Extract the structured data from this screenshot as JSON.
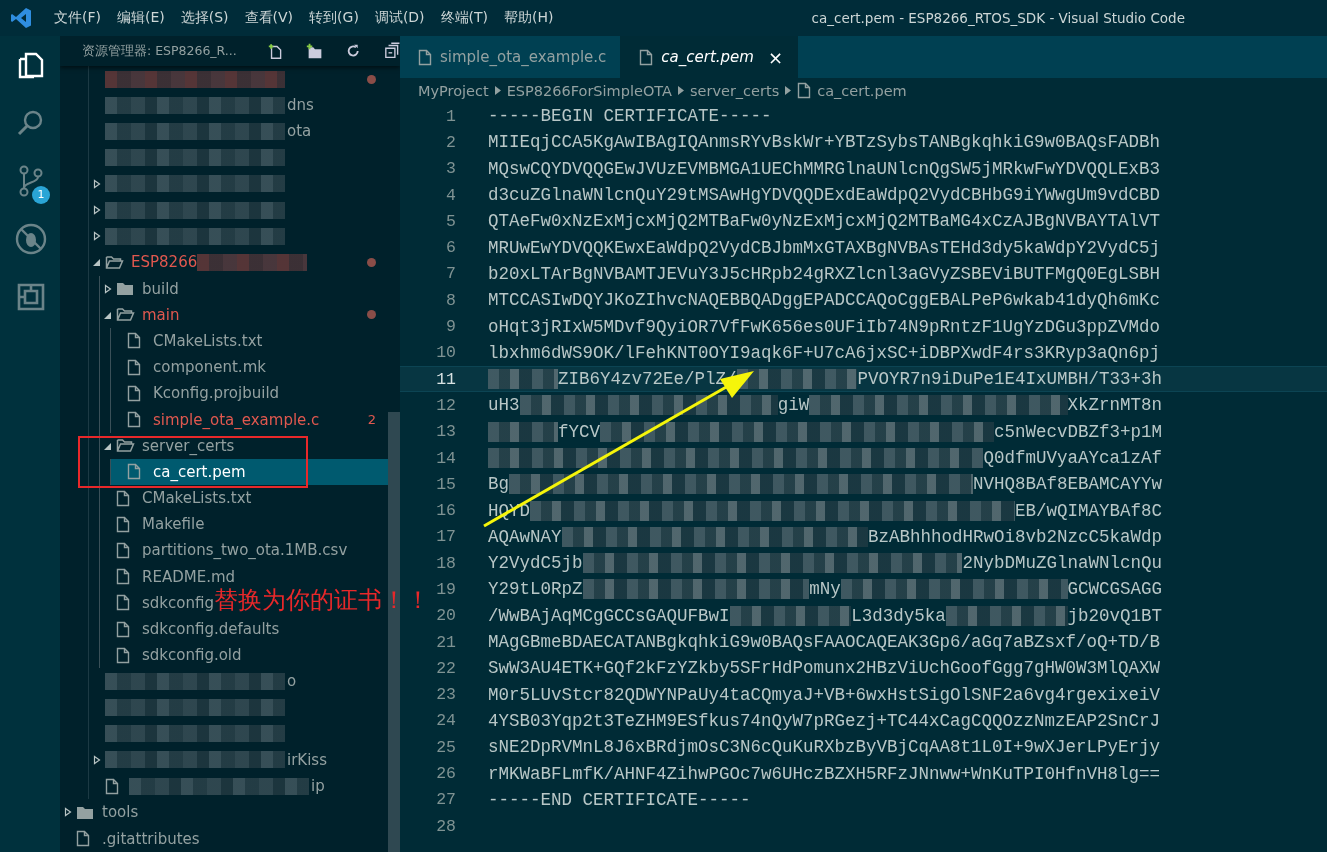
{
  "title_bar": {
    "menus": [
      "文件(F)",
      "编辑(E)",
      "选择(S)",
      "查看(V)",
      "转到(G)",
      "调试(D)",
      "终端(T)",
      "帮助(H)"
    ],
    "title": "ca_cert.pem - ESP8266_RTOS_SDK - Visual Studio Code"
  },
  "activity_bar": [
    {
      "kind": "explorer",
      "selected": true
    },
    {
      "kind": "search",
      "selected": false
    },
    {
      "kind": "source_control",
      "selected": false,
      "badge": "1"
    },
    {
      "kind": "debug",
      "selected": false
    },
    {
      "kind": "extensions",
      "selected": false
    }
  ],
  "sidebar": {
    "title": "资源管理器: ESP8266_R...",
    "tree": [
      {
        "kind": "group",
        "children": [
          {
            "kind": "blurred",
            "selected": false,
            "modified": true
          },
          {
            "kind": "blurred",
            "label": "dns",
            "selected": false,
            "modified": false
          },
          {
            "kind": "blurred",
            "label": "ota",
            "selected": false,
            "modified": false
          },
          {
            "kind": "blurred",
            "selected": false,
            "modified": false
          },
          {
            "kind": "blurred",
            "expanded": false,
            "selected": false,
            "modified": false
          },
          {
            "kind": "blurred",
            "expanded": false,
            "selected": false,
            "modified": false
          },
          {
            "kind": "blurred",
            "expanded": false,
            "selected": false,
            "modified": false
          },
          {
            "kind": "folder",
            "label": "ESP8266",
            "redacted": true,
            "expanded": true,
            "selected": false,
            "modified": true,
            "children": [
              {
                "kind": "folder",
                "label": "build",
                "expanded": false,
                "selected": false,
                "modified": false
              },
              {
                "kind": "folder",
                "label": "main",
                "expanded": true,
                "selected": false,
                "modified": true,
                "children": [
                  {
                    "kind": "file",
                    "label": "CMakeLists.txt",
                    "selected": false,
                    "modified": false
                  },
                  {
                    "kind": "file",
                    "label": "component.mk",
                    "selected": false,
                    "modified": false
                  },
                  {
                    "kind": "file",
                    "label": "Kconfig.projbuild",
                    "selected": false,
                    "modified": false
                  },
                  {
                    "kind": "file",
                    "label": "simple_ota_example.c",
                    "selected": false,
                    "modified": false,
                    "badge": "2"
                  }
                ]
              },
              {
                "kind": "folder",
                "label": "server_certs",
                "expanded": true,
                "selected": false,
                "modified": false,
                "children": [
                  {
                    "kind": "file",
                    "label": "ca_cert.pem",
                    "selected": true,
                    "modified": false
                  }
                ]
              },
              {
                "kind": "file",
                "label": "CMakeLists.txt",
                "selected": false,
                "modified": false
              },
              {
                "kind": "file",
                "label": "Makefile",
                "selected": false,
                "modified": false
              },
              {
                "kind": "file",
                "label": "partitions_two_ota.1MB.csv",
                "selected": false,
                "modified": false
              },
              {
                "kind": "file",
                "label": "README.md",
                "selected": false,
                "modified": false
              },
              {
                "kind": "file",
                "label": "sdkconfig",
                "selected": false,
                "modified": false
              },
              {
                "kind": "file",
                "label": "sdkconfig.defaults",
                "selected": false,
                "modified": false
              },
              {
                "kind": "file",
                "label": "sdkconfig.old",
                "selected": false,
                "modified": false
              }
            ]
          },
          {
            "kind": "blurred",
            "label": "o",
            "selected": false,
            "modified": false
          },
          {
            "kind": "blurred",
            "selected": false,
            "modified": false
          },
          {
            "kind": "blurred",
            "selected": false,
            "modified": false
          },
          {
            "kind": "blurred",
            "label": "irKiss",
            "expanded": false,
            "selected": false,
            "modified": false
          },
          {
            "kind": "blurred_file",
            "label": "ip",
            "selected": false,
            "modified": false
          }
        ]
      },
      {
        "kind": "folder",
        "label": "tools",
        "expanded": false,
        "selected": false,
        "modified": false
      },
      {
        "kind": "file",
        "label": ".gitattributes",
        "selected": false,
        "modified": false
      }
    ]
  },
  "editor": {
    "tabs": [
      {
        "label": "simple_ota_example.c",
        "selected": false
      },
      {
        "label": "ca_cert.pem",
        "selected": true,
        "close": "×"
      }
    ],
    "breadcrumbs": [
      {
        "label": "MyProject",
        "kind": "folder"
      },
      {
        "label": "ESP8266ForSimpleOTA",
        "kind": "folder"
      },
      {
        "label": "server_certs",
        "kind": "folder"
      },
      {
        "label": "ca_cert.pem",
        "kind": "file"
      }
    ],
    "lines": [
      {
        "number": "1",
        "current": false,
        "segments": [
          {
            "kind": "text",
            "text": "-----BEGIN CERTIFICATE-----"
          }
        ]
      },
      {
        "number": "2",
        "current": false,
        "segments": [
          {
            "kind": "text",
            "text": "MIIEqjCCA5KgAwIBAgIQAnmsRYvBskWr+YBTzSybsTANBgkqhkiG9w0BAQsFADBh"
          }
        ]
      },
      {
        "number": "3",
        "current": false,
        "segments": [
          {
            "kind": "text",
            "text": "MQswCQYDVQQGEwJVUzEVMBMGA1UEChMMRGlnaUNlcnQgSW5jMRkwFwYDVQQLExB3"
          }
        ]
      },
      {
        "number": "4",
        "current": false,
        "segments": [
          {
            "kind": "text",
            "text": "d3cuZGlnaWNlcnQuY29tMSAwHgYDVQQDExdEaWdpQ2VydCBHbG9iYWwgUm9vdCBD"
          }
        ]
      },
      {
        "number": "5",
        "current": false,
        "segments": [
          {
            "kind": "text",
            "text": "QTAeFw0xNzExMjcxMjQ2MTBaFw0yNzExMjcxMjQ2MTBaMG4xCzAJBgNVBAYTAlVT"
          }
        ]
      },
      {
        "number": "6",
        "current": false,
        "segments": [
          {
            "kind": "text",
            "text": "MRUwEwYDVQQKEwxEaWdpQ2VydCBJbmMxGTAXBgNVBAsTEHd3dy5kaWdpY2VydC5j"
          }
        ]
      },
      {
        "number": "7",
        "current": false,
        "segments": [
          {
            "kind": "text",
            "text": "b20xLTArBgNVBAMTJEVuY3J5cHRpb24gRXZlcnl3aGVyZSBEViBUTFMgQ0EgLSBH"
          }
        ]
      },
      {
        "number": "8",
        "current": false,
        "segments": [
          {
            "kind": "text",
            "text": "MTCCASIwDQYJKoZIhvcNAQEBBQADggEPADCCAQoCggEBALPeP6wkab41dyQh6mKc"
          }
        ]
      },
      {
        "number": "9",
        "current": false,
        "segments": [
          {
            "kind": "text",
            "text": "oHqt3jRIxW5MDvf9QyiOR7VfFwK656es0UFiIb74N9pRntzF1UgYzDGu3ppZVMdo"
          }
        ]
      },
      {
        "number": "10",
        "current": false,
        "segments": [
          {
            "kind": "text",
            "text": "lbxhm6dWS9OK/lFehKNT0OYI9aqk6F+U7cA6jxSC+iDBPXwdF4rs3KRyp3aQn6pj"
          }
        ]
      },
      {
        "number": "11",
        "current": true,
        "segments": [
          {
            "kind": "blur_short"
          },
          {
            "kind": "text",
            "text": "ZIB6Y4zv72Ee/PlZ/"
          },
          {
            "kind": "blur"
          },
          {
            "kind": "text",
            "text": "PVOYR7n9iDuPe1E4IxUMBH/T33+3h"
          }
        ]
      },
      {
        "number": "12",
        "current": false,
        "segments": [
          {
            "kind": "text",
            "text": "uH3"
          },
          {
            "kind": "blur"
          },
          {
            "kind": "text",
            "text": "giW"
          },
          {
            "kind": "blur"
          },
          {
            "kind": "text",
            "text": "XkZrnMT8n"
          }
        ]
      },
      {
        "number": "13",
        "current": false,
        "segments": [
          {
            "kind": "blur_short"
          },
          {
            "kind": "text",
            "text": "fYCV"
          },
          {
            "kind": "blur"
          },
          {
            "kind": "text",
            "text": "c5nWecvDBZf3+p1M"
          }
        ]
      },
      {
        "number": "14",
        "current": false,
        "segments": [
          {
            "kind": "blur"
          },
          {
            "kind": "text",
            "text": "Q0dfmUVyaAYca1zAf"
          }
        ]
      },
      {
        "number": "15",
        "current": false,
        "segments": [
          {
            "kind": "text",
            "text": "Bg"
          },
          {
            "kind": "blur"
          },
          {
            "kind": "text",
            "text": "NVHQ8BAf8EBAMCAYYw"
          }
        ]
      },
      {
        "number": "16",
        "current": false,
        "segments": [
          {
            "kind": "text",
            "text": "HQYD"
          },
          {
            "kind": "blur"
          },
          {
            "kind": "text",
            "text": "EB/wQIMAYBAf8C"
          }
        ]
      },
      {
        "number": "17",
        "current": false,
        "segments": [
          {
            "kind": "text",
            "text": "AQAwNAY"
          },
          {
            "kind": "blur"
          },
          {
            "kind": "text",
            "text": "BzABhhhodHRwOi8vb2NzcC5kaWdp"
          }
        ]
      },
      {
        "number": "18",
        "current": false,
        "segments": [
          {
            "kind": "text",
            "text": "Y2VydC5jb"
          },
          {
            "kind": "blur"
          },
          {
            "kind": "text",
            "text": "2NybDMuZGlnaWNlcnQu"
          }
        ]
      },
      {
        "number": "19",
        "current": false,
        "segments": [
          {
            "kind": "text",
            "text": "Y29tL0RpZ"
          },
          {
            "kind": "blur"
          },
          {
            "kind": "text",
            "text": "mNy"
          },
          {
            "kind": "blur"
          },
          {
            "kind": "text",
            "text": "GCWCGSAGG"
          }
        ]
      },
      {
        "number": "20",
        "current": false,
        "segments": [
          {
            "kind": "text",
            "text": "/WwBAjAqMCgGCCsGAQUFBwI"
          },
          {
            "kind": "blur"
          },
          {
            "kind": "text",
            "text": "L3d3dy5ka"
          },
          {
            "kind": "blur"
          },
          {
            "kind": "text",
            "text": "jb20vQ1BT"
          }
        ]
      },
      {
        "number": "21",
        "current": false,
        "segments": [
          {
            "kind": "text",
            "text": "MAgGBmeBDAECATANBgkqhkiG9w0BAQsFAAOCAQEAK3Gp6/aGq7aBZsxf/oQ+TD/B"
          }
        ]
      },
      {
        "number": "22",
        "current": false,
        "segments": [
          {
            "kind": "text",
            "text": "SwW3AU4ETK+GQf2kFzYZkby5SFrHdPomunx2HBzViUchGoofGgg7gHW0W3MlQAXW"
          }
        ]
      },
      {
        "number": "23",
        "current": false,
        "segments": [
          {
            "kind": "text",
            "text": "M0r5LUvStcr82QDWYNPaUy4taCQmyaJ+VB+6wxHstSigOlSNF2a6vg4rgexixeiV"
          }
        ]
      },
      {
        "number": "24",
        "current": false,
        "segments": [
          {
            "kind": "text",
            "text": "4YSB03Yqp2t3TeZHM9ESfkus74nQyW7pRGezj+TC44xCagCQQOzzNmzEAP2SnCrJ"
          }
        ]
      },
      {
        "number": "25",
        "current": false,
        "segments": [
          {
            "kind": "text",
            "text": "sNE2DpRVMnL8J6xBRdjmOsC3N6cQuKuRXbzByVBjCqAA8t1L0I+9wXJerLPyErjy"
          }
        ]
      },
      {
        "number": "26",
        "current": false,
        "segments": [
          {
            "kind": "text",
            "text": "rMKWaBFLmfK/AHNF4ZihwPGOc7w6UHczBZXH5RFzJNnww+WnKuTPI0HfnVH8lg=="
          }
        ]
      },
      {
        "number": "27",
        "current": false,
        "segments": [
          {
            "kind": "text",
            "text": "-----END CERTIFICATE-----"
          }
        ]
      },
      {
        "number": "28",
        "current": false
      }
    ]
  },
  "annotations": [
    {
      "kind": "box"
    },
    {
      "kind": "arrow"
    },
    {
      "kind": "text",
      "text": "替换为你的证书！！"
    }
  ]
}
